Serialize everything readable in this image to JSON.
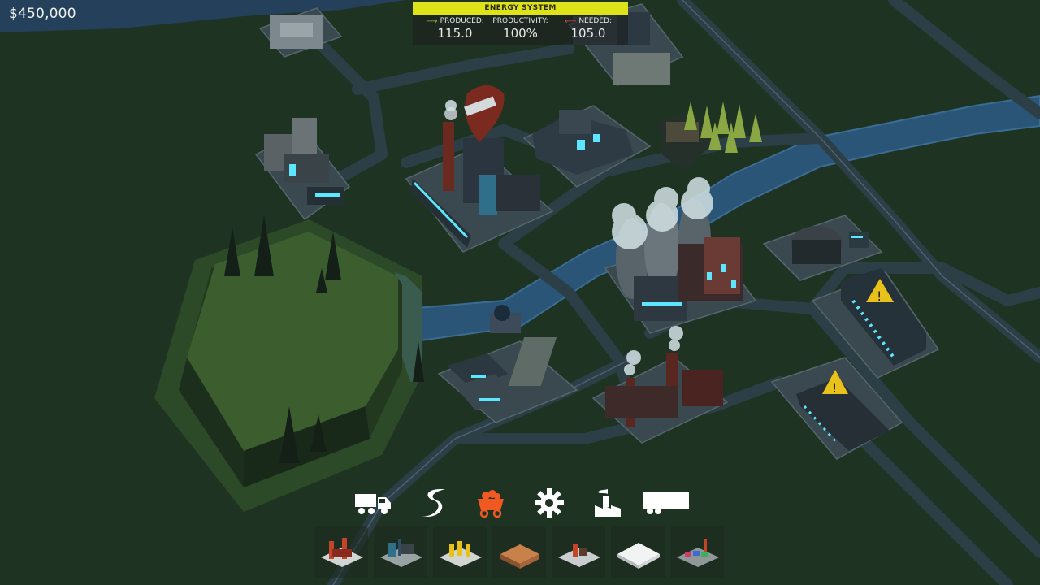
{
  "money": "$450,000",
  "energy": {
    "title": "ENERGY SYSTEM",
    "produced_label": "PRODUCED:",
    "produced_value": "115.0",
    "productivity_label": "PRODUCTIVITY:",
    "productivity_value": "100%",
    "needed_label": "NEEDED:",
    "needed_value": "105.0",
    "produced_color": "#7fbf3a",
    "needed_color": "#e0404a",
    "title_color": "#dde318"
  },
  "toolbar": {
    "categories": [
      {
        "icon": "truck-icon",
        "active": false
      },
      {
        "icon": "road-icon",
        "active": false
      },
      {
        "icon": "mine-cart-icon",
        "active": true,
        "active_color": "#f05a22"
      },
      {
        "icon": "gear-icon",
        "active": false
      },
      {
        "icon": "factory-icon",
        "active": false
      },
      {
        "icon": "trailer-icon",
        "active": false
      }
    ],
    "buildings": [
      {
        "icon": "red-factory-icon"
      },
      {
        "icon": "blue-machinery-icon"
      },
      {
        "icon": "yellow-generators-icon"
      },
      {
        "icon": "wooden-crate-icon"
      },
      {
        "icon": "small-plant-icon"
      },
      {
        "icon": "white-warehouse-icon"
      },
      {
        "icon": "cargo-depot-icon"
      }
    ]
  },
  "colors": {
    "grass": "#1f3323",
    "road": "#2c3e46",
    "river": "#2a5577",
    "hill_top": "#3c5e2f",
    "glow": "#5ee6ff"
  }
}
